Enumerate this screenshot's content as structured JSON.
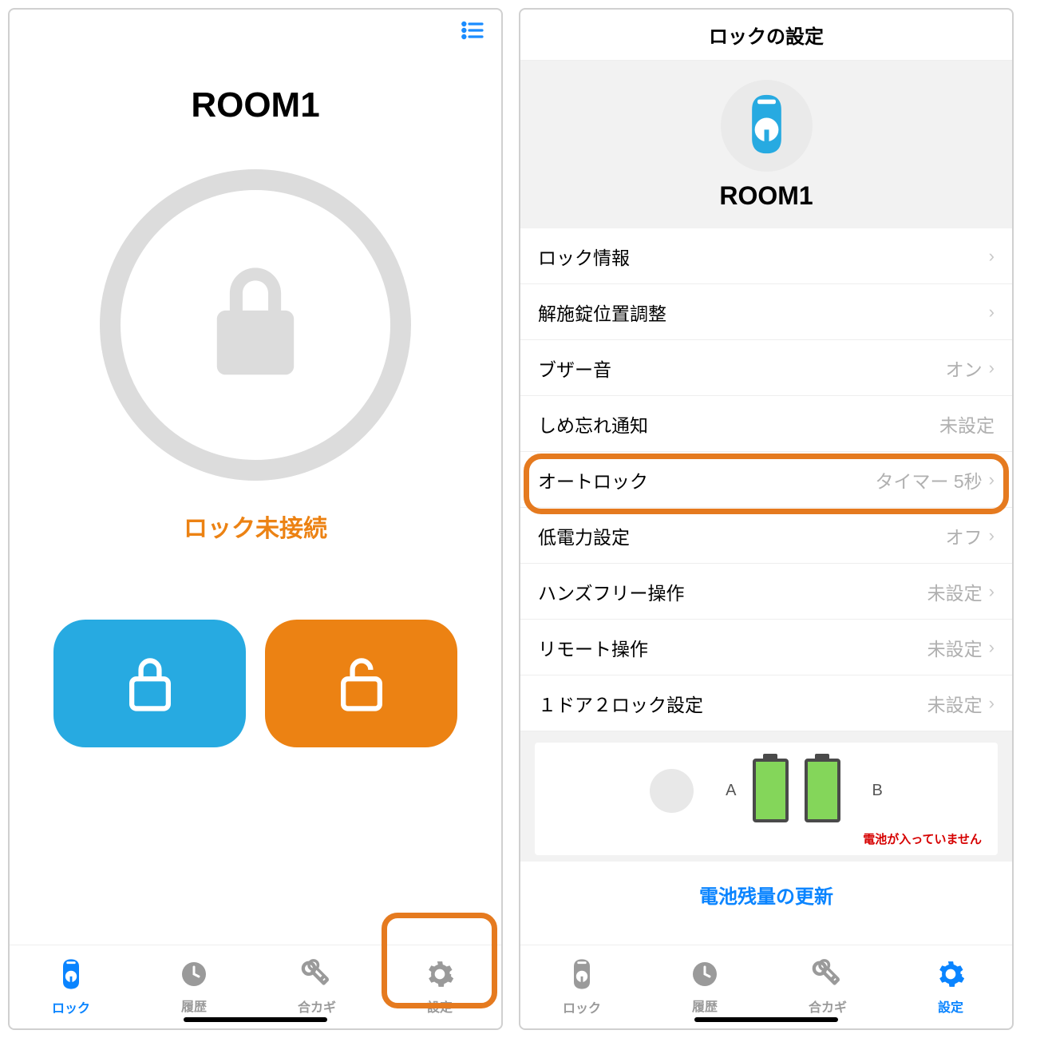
{
  "left": {
    "room": "ROOM1",
    "status": "ロック未接続",
    "tabs": {
      "lock": "ロック",
      "history": "履歴",
      "key": "合カギ",
      "settings": "設定"
    }
  },
  "right": {
    "title": "ロックの設定",
    "deviceName": "ROOM1",
    "rows": {
      "info": {
        "label": "ロック情報",
        "value": ""
      },
      "position": {
        "label": "解施錠位置調整",
        "value": ""
      },
      "buzzer": {
        "label": "ブザー音",
        "value": "オン"
      },
      "forgot": {
        "label": "しめ忘れ通知",
        "value": "未設定"
      },
      "autolock": {
        "label": "オートロック",
        "value": "タイマー 5秒"
      },
      "lowpower": {
        "label": "低電力設定",
        "value": "オフ"
      },
      "handsfree": {
        "label": "ハンズフリー操作",
        "value": "未設定"
      },
      "remote": {
        "label": "リモート操作",
        "value": "未設定"
      },
      "onedoor": {
        "label": "１ドア２ロック設定",
        "value": "未設定"
      }
    },
    "battery": {
      "a": "A",
      "b": "B",
      "warning": "電池が入っていません"
    },
    "updateLink": "電池残量の更新",
    "tabs": {
      "lock": "ロック",
      "history": "履歴",
      "key": "合カギ",
      "settings": "設定"
    }
  }
}
